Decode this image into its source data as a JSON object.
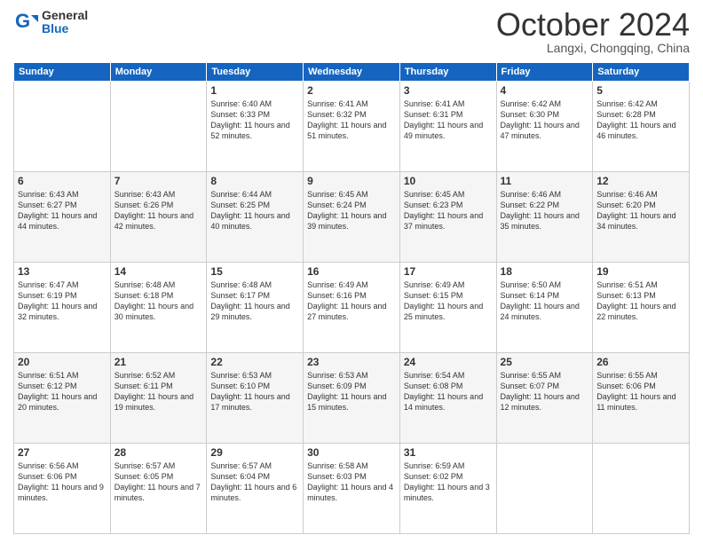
{
  "header": {
    "logo_general": "General",
    "logo_blue": "Blue",
    "month_title": "October 2024",
    "location": "Langxi, Chongqing, China"
  },
  "weekdays": [
    "Sunday",
    "Monday",
    "Tuesday",
    "Wednesday",
    "Thursday",
    "Friday",
    "Saturday"
  ],
  "weeks": [
    [
      {
        "day": "",
        "sunrise": "",
        "sunset": "",
        "daylight": ""
      },
      {
        "day": "",
        "sunrise": "",
        "sunset": "",
        "daylight": ""
      },
      {
        "day": "1",
        "sunrise": "Sunrise: 6:40 AM",
        "sunset": "Sunset: 6:33 PM",
        "daylight": "Daylight: 11 hours and 52 minutes."
      },
      {
        "day": "2",
        "sunrise": "Sunrise: 6:41 AM",
        "sunset": "Sunset: 6:32 PM",
        "daylight": "Daylight: 11 hours and 51 minutes."
      },
      {
        "day": "3",
        "sunrise": "Sunrise: 6:41 AM",
        "sunset": "Sunset: 6:31 PM",
        "daylight": "Daylight: 11 hours and 49 minutes."
      },
      {
        "day": "4",
        "sunrise": "Sunrise: 6:42 AM",
        "sunset": "Sunset: 6:30 PM",
        "daylight": "Daylight: 11 hours and 47 minutes."
      },
      {
        "day": "5",
        "sunrise": "Sunrise: 6:42 AM",
        "sunset": "Sunset: 6:28 PM",
        "daylight": "Daylight: 11 hours and 46 minutes."
      }
    ],
    [
      {
        "day": "6",
        "sunrise": "Sunrise: 6:43 AM",
        "sunset": "Sunset: 6:27 PM",
        "daylight": "Daylight: 11 hours and 44 minutes."
      },
      {
        "day": "7",
        "sunrise": "Sunrise: 6:43 AM",
        "sunset": "Sunset: 6:26 PM",
        "daylight": "Daylight: 11 hours and 42 minutes."
      },
      {
        "day": "8",
        "sunrise": "Sunrise: 6:44 AM",
        "sunset": "Sunset: 6:25 PM",
        "daylight": "Daylight: 11 hours and 40 minutes."
      },
      {
        "day": "9",
        "sunrise": "Sunrise: 6:45 AM",
        "sunset": "Sunset: 6:24 PM",
        "daylight": "Daylight: 11 hours and 39 minutes."
      },
      {
        "day": "10",
        "sunrise": "Sunrise: 6:45 AM",
        "sunset": "Sunset: 6:23 PM",
        "daylight": "Daylight: 11 hours and 37 minutes."
      },
      {
        "day": "11",
        "sunrise": "Sunrise: 6:46 AM",
        "sunset": "Sunset: 6:22 PM",
        "daylight": "Daylight: 11 hours and 35 minutes."
      },
      {
        "day": "12",
        "sunrise": "Sunrise: 6:46 AM",
        "sunset": "Sunset: 6:20 PM",
        "daylight": "Daylight: 11 hours and 34 minutes."
      }
    ],
    [
      {
        "day": "13",
        "sunrise": "Sunrise: 6:47 AM",
        "sunset": "Sunset: 6:19 PM",
        "daylight": "Daylight: 11 hours and 32 minutes."
      },
      {
        "day": "14",
        "sunrise": "Sunrise: 6:48 AM",
        "sunset": "Sunset: 6:18 PM",
        "daylight": "Daylight: 11 hours and 30 minutes."
      },
      {
        "day": "15",
        "sunrise": "Sunrise: 6:48 AM",
        "sunset": "Sunset: 6:17 PM",
        "daylight": "Daylight: 11 hours and 29 minutes."
      },
      {
        "day": "16",
        "sunrise": "Sunrise: 6:49 AM",
        "sunset": "Sunset: 6:16 PM",
        "daylight": "Daylight: 11 hours and 27 minutes."
      },
      {
        "day": "17",
        "sunrise": "Sunrise: 6:49 AM",
        "sunset": "Sunset: 6:15 PM",
        "daylight": "Daylight: 11 hours and 25 minutes."
      },
      {
        "day": "18",
        "sunrise": "Sunrise: 6:50 AM",
        "sunset": "Sunset: 6:14 PM",
        "daylight": "Daylight: 11 hours and 24 minutes."
      },
      {
        "day": "19",
        "sunrise": "Sunrise: 6:51 AM",
        "sunset": "Sunset: 6:13 PM",
        "daylight": "Daylight: 11 hours and 22 minutes."
      }
    ],
    [
      {
        "day": "20",
        "sunrise": "Sunrise: 6:51 AM",
        "sunset": "Sunset: 6:12 PM",
        "daylight": "Daylight: 11 hours and 20 minutes."
      },
      {
        "day": "21",
        "sunrise": "Sunrise: 6:52 AM",
        "sunset": "Sunset: 6:11 PM",
        "daylight": "Daylight: 11 hours and 19 minutes."
      },
      {
        "day": "22",
        "sunrise": "Sunrise: 6:53 AM",
        "sunset": "Sunset: 6:10 PM",
        "daylight": "Daylight: 11 hours and 17 minutes."
      },
      {
        "day": "23",
        "sunrise": "Sunrise: 6:53 AM",
        "sunset": "Sunset: 6:09 PM",
        "daylight": "Daylight: 11 hours and 15 minutes."
      },
      {
        "day": "24",
        "sunrise": "Sunrise: 6:54 AM",
        "sunset": "Sunset: 6:08 PM",
        "daylight": "Daylight: 11 hours and 14 minutes."
      },
      {
        "day": "25",
        "sunrise": "Sunrise: 6:55 AM",
        "sunset": "Sunset: 6:07 PM",
        "daylight": "Daylight: 11 hours and 12 minutes."
      },
      {
        "day": "26",
        "sunrise": "Sunrise: 6:55 AM",
        "sunset": "Sunset: 6:06 PM",
        "daylight": "Daylight: 11 hours and 11 minutes."
      }
    ],
    [
      {
        "day": "27",
        "sunrise": "Sunrise: 6:56 AM",
        "sunset": "Sunset: 6:06 PM",
        "daylight": "Daylight: 11 hours and 9 minutes."
      },
      {
        "day": "28",
        "sunrise": "Sunrise: 6:57 AM",
        "sunset": "Sunset: 6:05 PM",
        "daylight": "Daylight: 11 hours and 7 minutes."
      },
      {
        "day": "29",
        "sunrise": "Sunrise: 6:57 AM",
        "sunset": "Sunset: 6:04 PM",
        "daylight": "Daylight: 11 hours and 6 minutes."
      },
      {
        "day": "30",
        "sunrise": "Sunrise: 6:58 AM",
        "sunset": "Sunset: 6:03 PM",
        "daylight": "Daylight: 11 hours and 4 minutes."
      },
      {
        "day": "31",
        "sunrise": "Sunrise: 6:59 AM",
        "sunset": "Sunset: 6:02 PM",
        "daylight": "Daylight: 11 hours and 3 minutes."
      },
      {
        "day": "",
        "sunrise": "",
        "sunset": "",
        "daylight": ""
      },
      {
        "day": "",
        "sunrise": "",
        "sunset": "",
        "daylight": ""
      }
    ]
  ]
}
